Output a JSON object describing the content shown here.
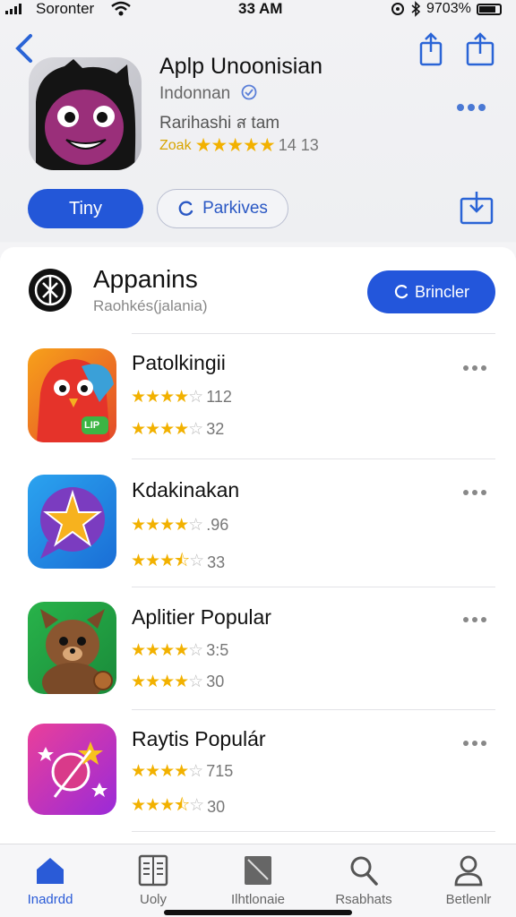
{
  "status_bar": {
    "carrier": "Soronter",
    "time": "33 AM",
    "battery": "9703%"
  },
  "app": {
    "title": "Aplp Unoonisian",
    "subtitle": "Indonnan",
    "developer": "Rarihashi ส tam",
    "rating_label": "Zoak",
    "rating_count": "14 13",
    "primary_button": "Tiny",
    "secondary_button": "Parkives"
  },
  "section": {
    "title": "Appanins",
    "subtitle": "Raohkés(jalania)",
    "browse_button": "Brincler"
  },
  "apps": [
    {
      "name": "Patolkingii",
      "ratings": [
        {
          "stars": 4,
          "count": "112"
        },
        {
          "stars": 4,
          "count": "32"
        }
      ],
      "icon": "red-parrot-icon",
      "badge": "LIP"
    },
    {
      "name": "Kdakinakan",
      "ratings": [
        {
          "stars": 4,
          "count": ".96"
        },
        {
          "stars": 3.5,
          "count": "33"
        }
      ],
      "icon": "star-bubble-icon"
    },
    {
      "name": "Aplitier Popular",
      "ratings": [
        {
          "stars": 4,
          "count": "3:5"
        },
        {
          "stars": 4,
          "count": "30"
        }
      ],
      "icon": "bear-icon"
    },
    {
      "name": "Raytis Populár",
      "ratings": [
        {
          "stars": 4,
          "count": "715"
        },
        {
          "stars": 3.5,
          "count": "30"
        }
      ],
      "icon": "magic-stars-icon"
    }
  ],
  "tabs": [
    {
      "label": "Inadrdd",
      "icon": "home-icon",
      "active": true
    },
    {
      "label": "Uoly",
      "icon": "book-icon",
      "active": false
    },
    {
      "label": "Ilhtlonaie",
      "icon": "tablet-icon",
      "active": false
    },
    {
      "label": "Rsabhats",
      "icon": "search-icon",
      "active": false
    },
    {
      "label": "Betlenlr",
      "icon": "person-icon",
      "active": false
    }
  ],
  "colors": {
    "accent": "#2356db",
    "star": "#f2b100"
  }
}
